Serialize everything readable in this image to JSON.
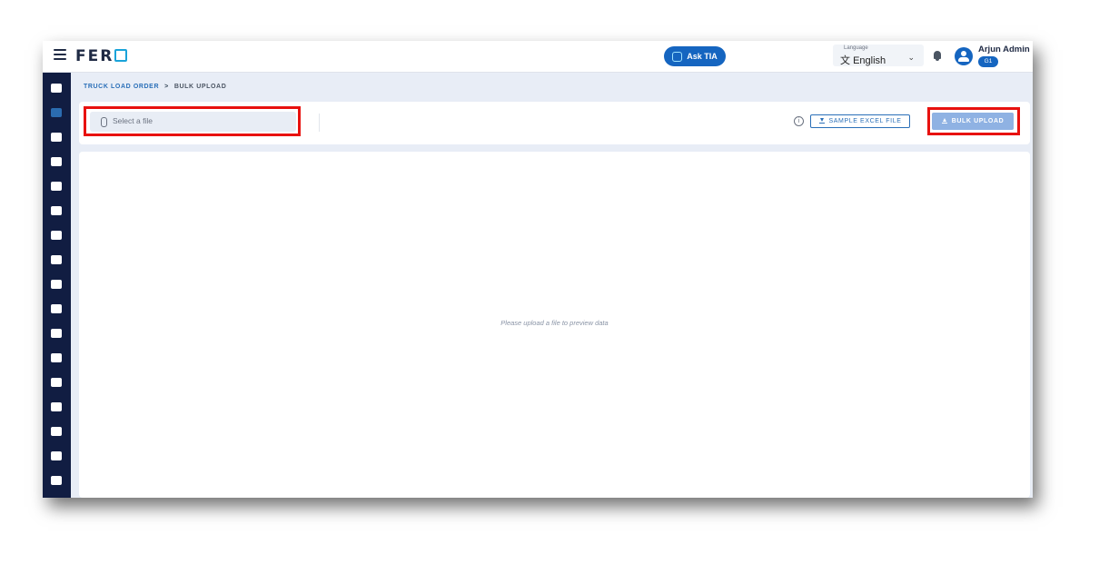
{
  "app": {
    "brand": "FER",
    "ask_tia_label": "Ask TIA"
  },
  "language": {
    "label": "Language",
    "value": "English"
  },
  "user": {
    "name": "Arjun Admin",
    "badge": "G1"
  },
  "breadcrumb": {
    "parent": "TRUCK LOAD ORDER",
    "separator": ">",
    "current": "BULK UPLOAD"
  },
  "toolbar": {
    "file_placeholder": "Select a file",
    "info_glyph": "i",
    "sample_label": "SAMPLE EXCEL FILE",
    "bulk_label": "BULK UPLOAD"
  },
  "preview": {
    "message": "Please upload a file to preview data"
  },
  "sidebar": {
    "items": [
      {
        "icon": "dashboard-icon"
      },
      {
        "icon": "orders-icon",
        "active": true
      },
      {
        "icon": "loading-dock-icon"
      },
      {
        "icon": "container-icon"
      },
      {
        "icon": "truck-icon"
      },
      {
        "icon": "document-icon"
      },
      {
        "icon": "database-icon"
      },
      {
        "icon": "vehicle-search-icon"
      },
      {
        "icon": "payments-icon"
      },
      {
        "icon": "delivery-truck-icon"
      },
      {
        "icon": "warehouse-icon"
      },
      {
        "icon": "buildings-icon"
      },
      {
        "icon": "users-icon"
      },
      {
        "icon": "reports-settings-icon"
      },
      {
        "icon": "settings-icon"
      },
      {
        "icon": "invoice-icon"
      },
      {
        "icon": "archive-icon"
      }
    ]
  },
  "colors": {
    "primary": "#1565c0",
    "sidebar_bg": "#111d42",
    "highlight": "#e8110f",
    "link": "#2a6fb8"
  }
}
